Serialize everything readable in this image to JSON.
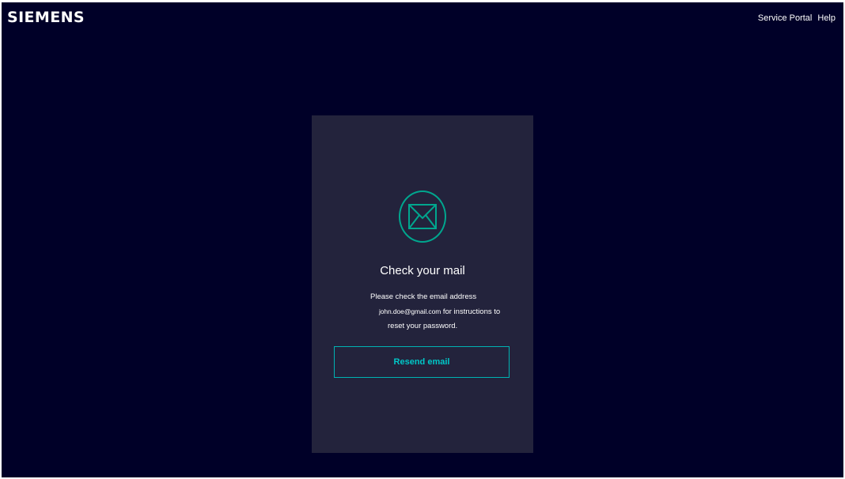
{
  "header": {
    "logo": "SIEMENS",
    "links": [
      "Service Portal",
      "Help"
    ]
  },
  "card": {
    "icon": "envelope-icon",
    "title": "Check your mail",
    "message_line1": "Please check the email address",
    "email": "john.doe@gmail.com",
    "message_line2_suffix": " for instructions to",
    "message_line3": "reset your password.",
    "resend_label": "Resend email"
  },
  "colors": {
    "page_background": "#000028",
    "card_background": "#23233c",
    "accent_green": "#00a68e",
    "accent_cyan": "#00c8c8"
  }
}
